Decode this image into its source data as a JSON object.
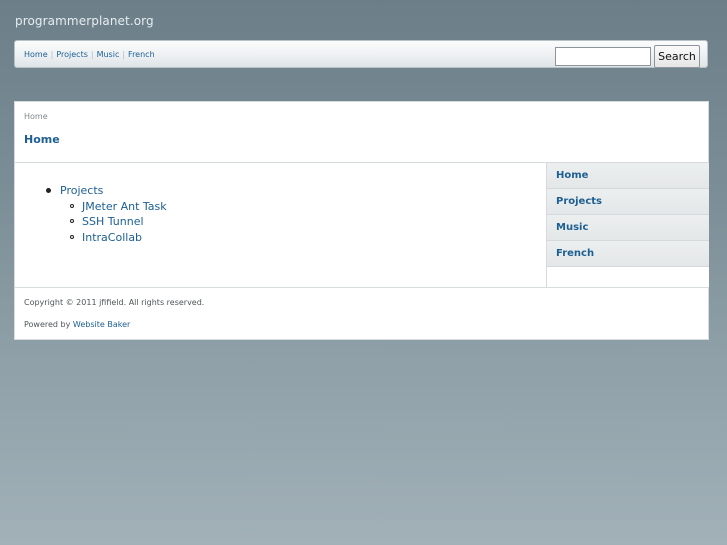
{
  "site": {
    "title": "programmerplanet.org"
  },
  "topnav": {
    "items": [
      "Home",
      "Projects",
      "Music",
      "French"
    ],
    "separator": "|"
  },
  "search": {
    "placeholder": "",
    "value": "",
    "button_label": "Search"
  },
  "breadcrumb": "Home",
  "page": {
    "title": "Home"
  },
  "content_tree": {
    "top": "Projects",
    "children": [
      "JMeter Ant Task",
      "SSH Tunnel",
      "IntraCollab"
    ]
  },
  "sidebar": {
    "items": [
      "Home",
      "Projects",
      "Music",
      "French"
    ]
  },
  "footer": {
    "copyright": "Copyright © 2011 jfifield. All rights reserved.",
    "powered_prefix": "Powered by ",
    "powered_link": "Website Baker"
  },
  "colors": {
    "link": "#1c5f93",
    "background_top": "#6c7f89",
    "background_bottom": "#a2b1b8"
  }
}
